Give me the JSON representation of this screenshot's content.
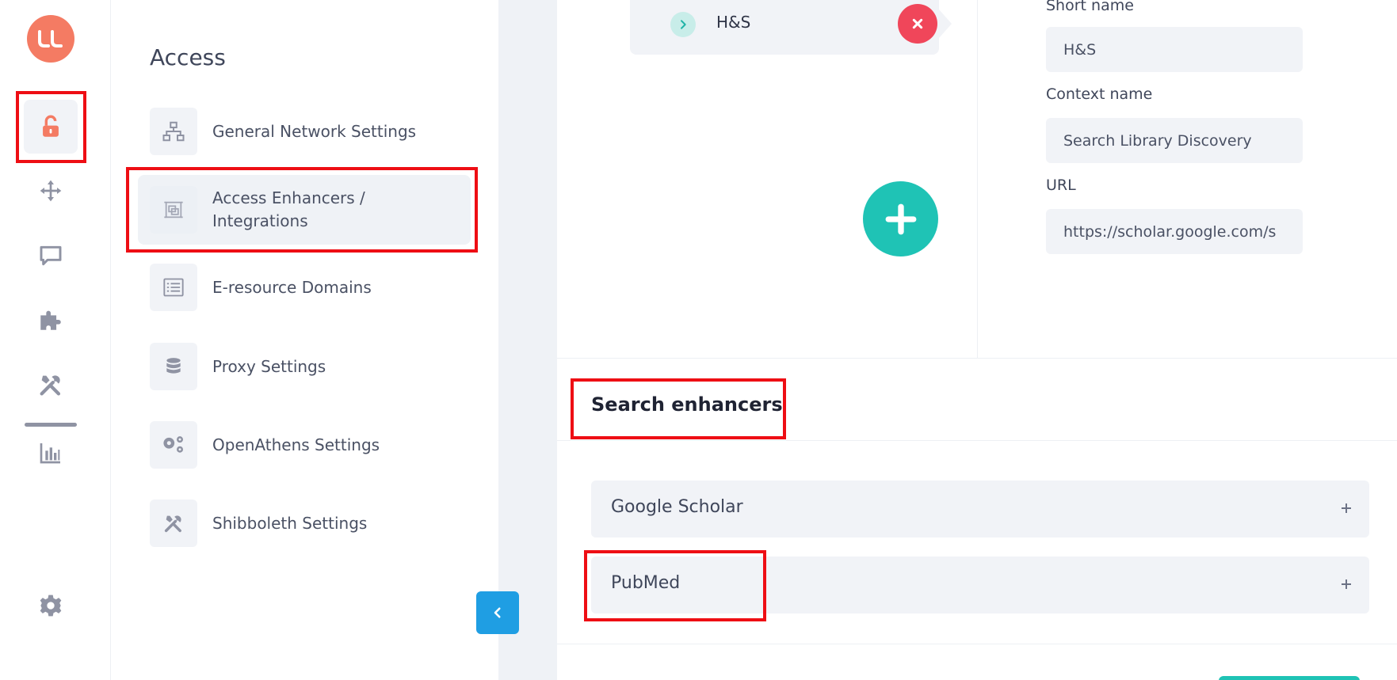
{
  "rail": {
    "logo_text": "LL",
    "items": [
      {
        "icon": "unlock-icon",
        "active": true
      },
      {
        "icon": "move-icon"
      },
      {
        "icon": "chat-icon"
      },
      {
        "icon": "puzzle-icon"
      },
      {
        "icon": "tools-icon"
      },
      {
        "icon": "bar-chart-icon"
      },
      {
        "icon": "gear-icon"
      }
    ],
    "colors": {
      "accent": "#f47b63",
      "icon": "#8f93a3"
    }
  },
  "subnav": {
    "title": "Access",
    "items": [
      {
        "label": "General Network Settings",
        "icon": "network-icon"
      },
      {
        "label": "Access Enhancers / Integrations",
        "icon": "integration-icon",
        "active": true
      },
      {
        "label": "E-resource Domains",
        "icon": "list-icon"
      },
      {
        "label": "Proxy Settings",
        "icon": "database-icon"
      },
      {
        "label": "OpenAthens Settings",
        "icon": "cogs-icon"
      },
      {
        "label": "Shibboleth Settings",
        "icon": "tools-icon"
      }
    ]
  },
  "main": {
    "tree_node": {
      "label": "H&S"
    },
    "form": {
      "short_name_label": "Short name",
      "short_name_value": "H&S",
      "context_name_label": "Context name",
      "context_name_value": "Search Library Discovery",
      "url_label": "URL",
      "url_value": "https://scholar.google.com/s"
    },
    "search_enhancers": {
      "title": "Search enhancers",
      "items": [
        "Google Scholar",
        "PubMed"
      ]
    },
    "colors": {
      "add": "#1fc3b5",
      "remove": "#f0465a",
      "collapse": "#1f9ee3",
      "highlight": "#ee0e14"
    }
  }
}
